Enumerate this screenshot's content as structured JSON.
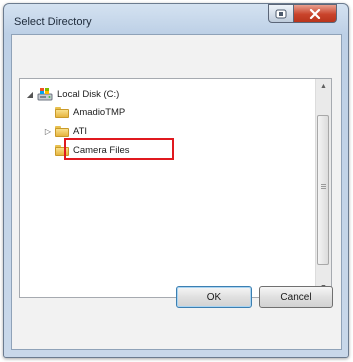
{
  "window": {
    "title": "Select Directory"
  },
  "tree": {
    "root": {
      "label": "Local Disk (C:)",
      "expander": "◢"
    },
    "children": [
      {
        "label": "AmadioTMP",
        "expander": ""
      },
      {
        "label": "ATI",
        "expander": "▷"
      },
      {
        "label": "Camera Files",
        "expander": "",
        "highlighted": true
      }
    ]
  },
  "scrollbar": {
    "up_arrow": "▲",
    "down_arrow": "▼"
  },
  "buttons": {
    "ok_label": "OK",
    "cancel_label": "Cancel"
  },
  "colors": {
    "highlight_box": "#e0191f",
    "close_button": "#c9432b",
    "folder": "#e6b53e"
  }
}
